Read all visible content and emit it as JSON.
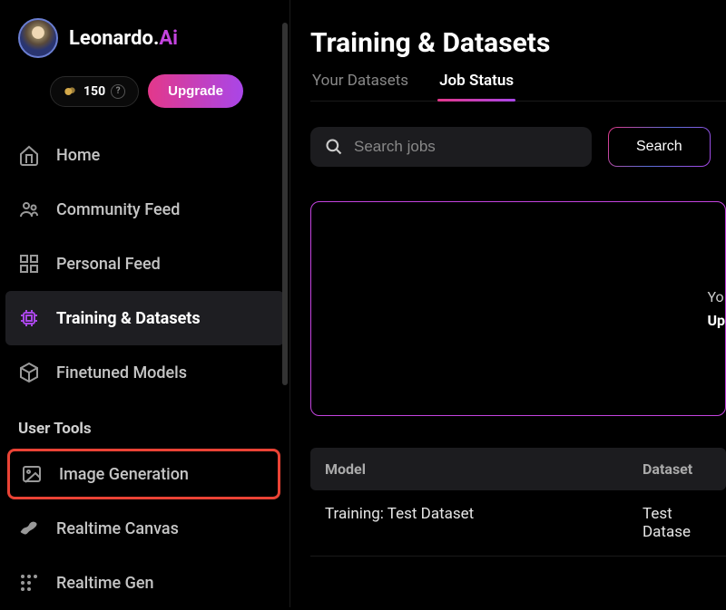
{
  "brand": {
    "name": "Leonardo.",
    "accent": "Ai"
  },
  "credits": {
    "amount": "150"
  },
  "upgrade_label": "Upgrade",
  "nav": {
    "home": "Home",
    "community_feed": "Community Feed",
    "personal_feed": "Personal Feed",
    "training_datasets": "Training & Datasets",
    "finetuned_models": "Finetuned Models"
  },
  "user_tools": {
    "header": "User Tools",
    "image_generation": "Image Generation",
    "realtime_canvas": "Realtime Canvas",
    "realtime_gen": "Realtime Gen"
  },
  "main": {
    "title": "Training & Datasets",
    "tabs": {
      "your_datasets": "Your Datasets",
      "job_status": "Job Status"
    },
    "search": {
      "placeholder": "Search jobs",
      "button": "Search"
    },
    "info": {
      "line1": "Yo",
      "line2": "Up"
    },
    "table": {
      "columns": {
        "model": "Model",
        "dataset": "Dataset"
      },
      "rows": [
        {
          "model": "Training: Test Dataset",
          "dataset": "Test Datase"
        }
      ]
    }
  }
}
